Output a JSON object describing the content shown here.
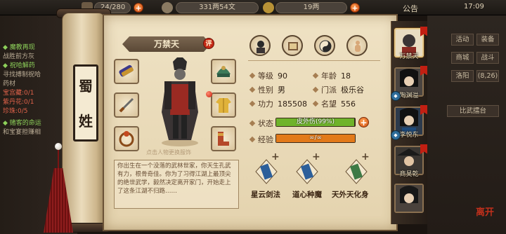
{
  "topbar": {
    "stamina": "24/280",
    "money": "331两54文",
    "ingot": "19两",
    "notice": "公告",
    "clock": "17:09"
  },
  "quests": [
    {
      "text": "◆ 魔教再现",
      "style": "green"
    },
    {
      "text": "战胜前方灰",
      "style": "grey"
    },
    {
      "text": "◆ 祝哈解药",
      "style": "green"
    },
    {
      "text": "寻找搏制祝哈",
      "style": "grey"
    },
    {
      "text": "药材",
      "style": "grey"
    },
    {
      "text": "宝宫藏:0/1",
      "style": "red"
    },
    {
      "text": "紫丹花:0/1",
      "style": "red"
    },
    {
      "text": "珍珠:0/5",
      "style": "red"
    },
    {
      "text": "◆ 赌客的命运",
      "style": "green"
    },
    {
      "text": "和宝宴担赚相",
      "style": "grey"
    }
  ],
  "sect": {
    "char1": "蜀",
    "char2": "姓"
  },
  "character": {
    "name": "万禁天",
    "badge": "评",
    "hint": "点击人物更换服饰",
    "stats": {
      "level_label": "等级",
      "level": "90",
      "age_label": "年龄",
      "age": "18",
      "gender_label": "性别",
      "gender": "男",
      "faction_label": "门派",
      "faction": "极乐谷",
      "power_label": "功力",
      "power": "185508",
      "fame_label": "名望",
      "fame": "556"
    },
    "status_label": "状态",
    "status_text": "皮外伤(99%)",
    "status_value": 0.99,
    "exp_label": "经验",
    "exp_text": "∞/∞",
    "exp_value": 1.0,
    "bio": "你出生在一个没落的武林世家，你天生孔武有力，根骨奇佳。你为了习得江湖上最顶尖的绝世武学，毅然决定离开家门，开始走上了这条江湖不归路……"
  },
  "skills": [
    {
      "name": "星云剑法"
    },
    {
      "name": "道心种魔"
    },
    {
      "name": "天外天化身"
    }
  ],
  "roster": [
    {
      "name": "万禁天"
    },
    {
      "name": "陶渊溢"
    },
    {
      "name": "李悦东"
    },
    {
      "name": "商昊乾"
    }
  ],
  "right_menu": {
    "b1": "活动",
    "b2": "装备",
    "b3": "商城",
    "b4": "战斗",
    "b5": "洛阳",
    "b6": "(8,26)",
    "b7": "比武擂台"
  },
  "brand": "离开",
  "colors": {
    "status_fill": "#6fb32b",
    "exp_fill": "#e27a1a",
    "accent_red": "#c21f12"
  }
}
